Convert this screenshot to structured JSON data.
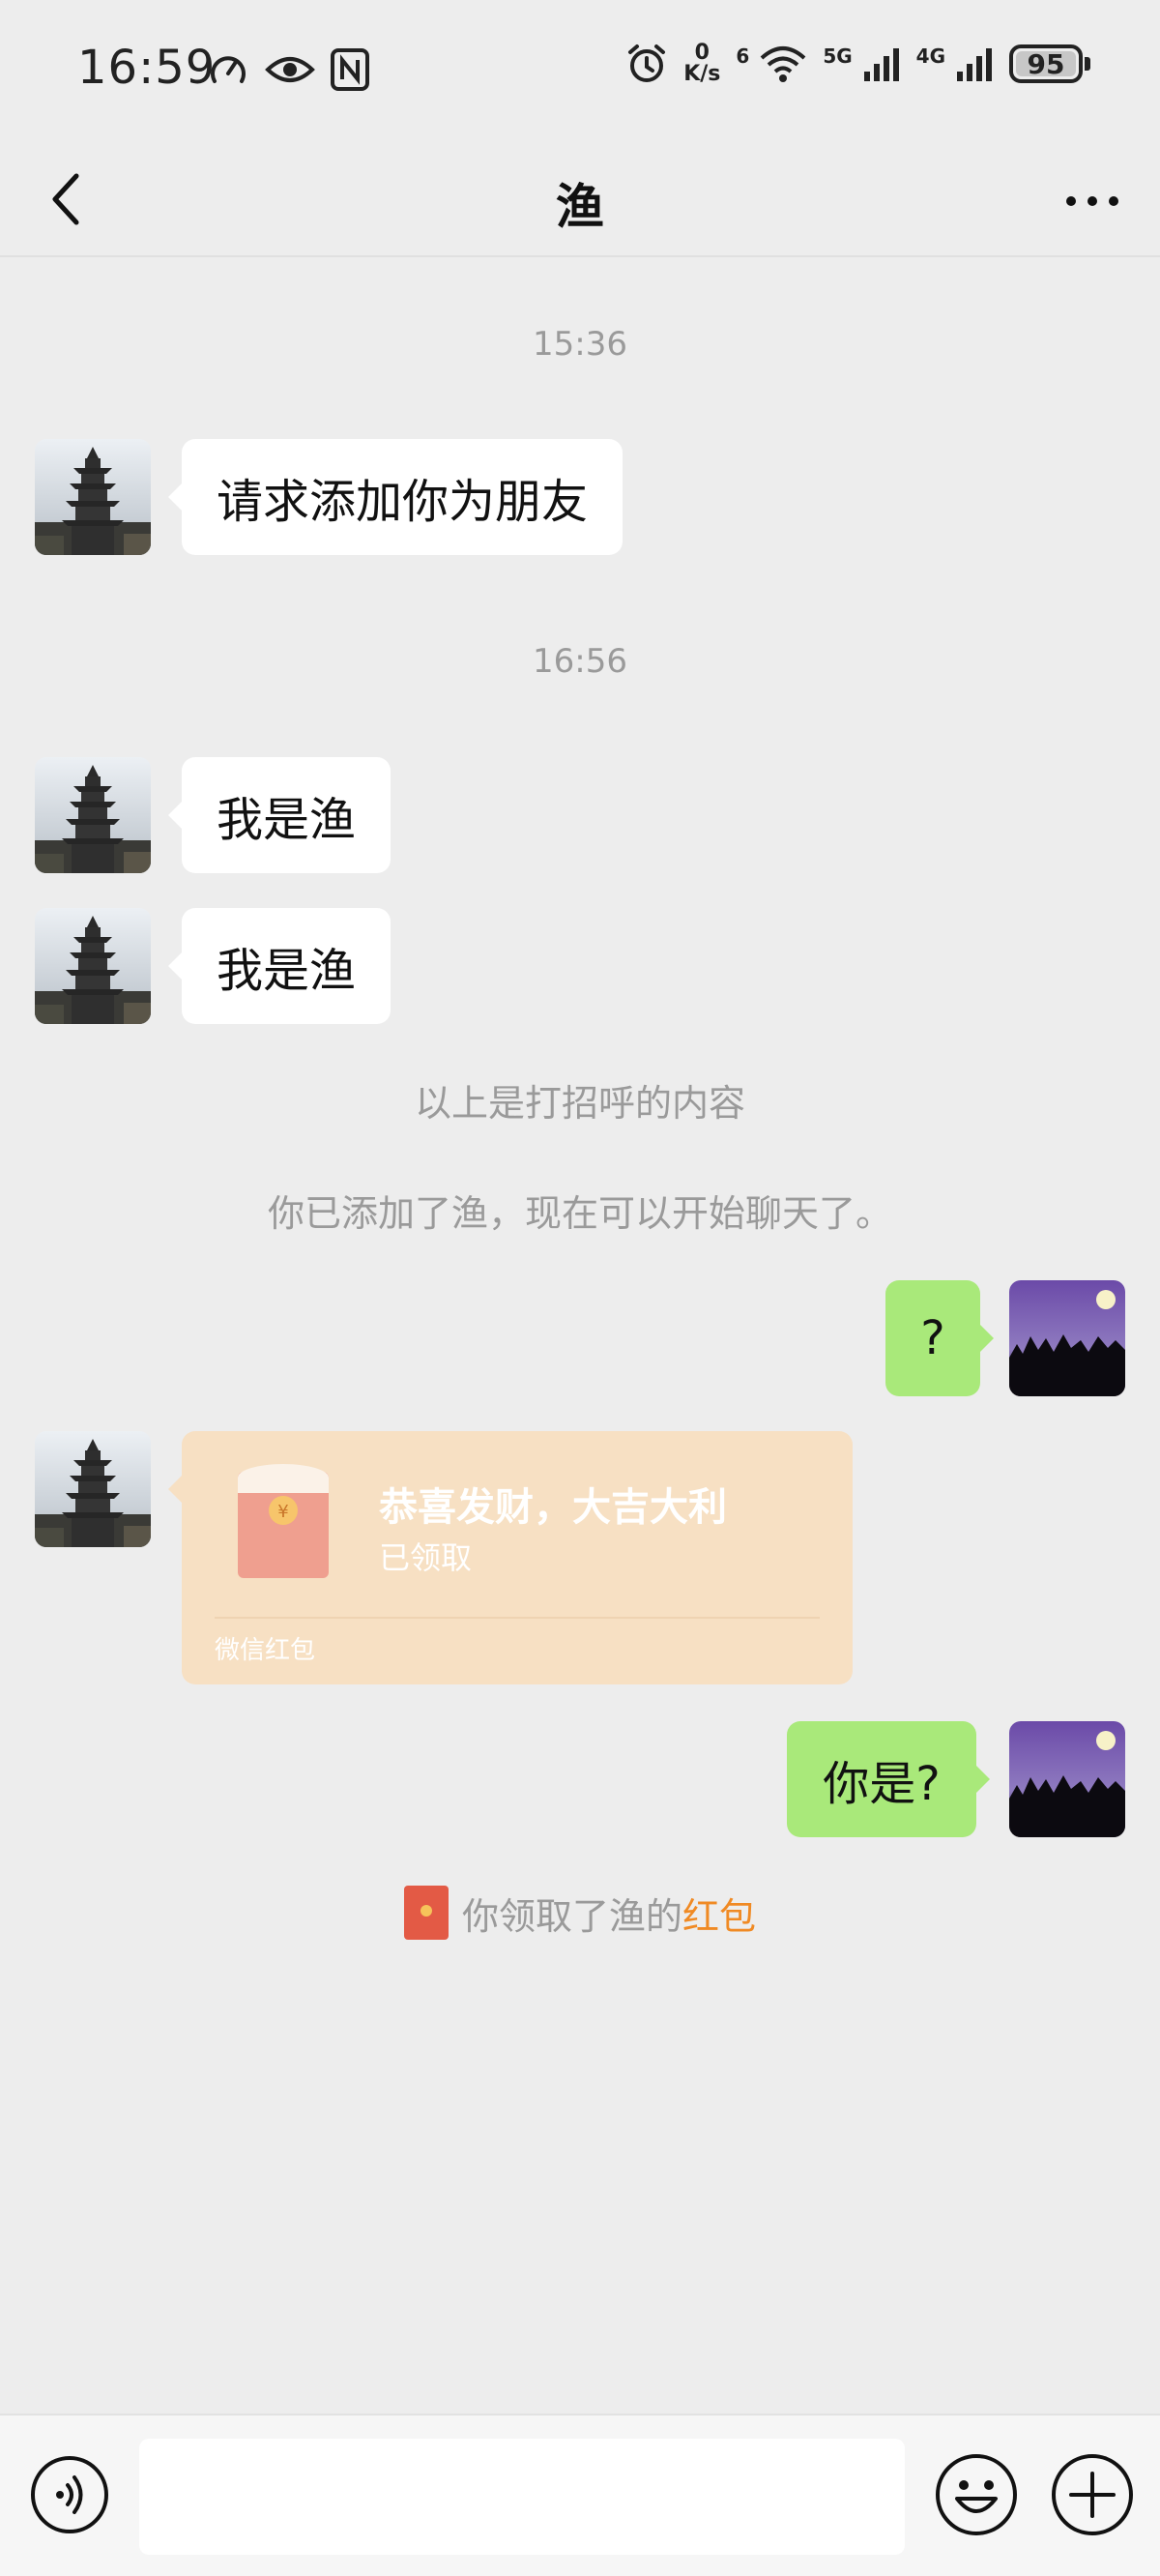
{
  "status_bar": {
    "time": "16:59",
    "net_speed_value": "0",
    "net_speed_unit": "K/s",
    "wifi_badge": "6",
    "network_1": "5G",
    "network_2": "4G",
    "battery": "95"
  },
  "nav": {
    "title": "渔"
  },
  "messages": {
    "ts1": "15:36",
    "m1": "请求添加你为朋友",
    "ts2": "16:56",
    "m2": "我是渔",
    "m3": "我是渔",
    "sys1": "以上是打招呼的内容",
    "sys2": "你已添加了渔，现在可以开始聊天了。",
    "m4": "?",
    "m5": "你是?"
  },
  "red_packet": {
    "title": "恭喜发财，大吉大利",
    "status": "已领取",
    "footer": "微信红包",
    "symbol": "¥"
  },
  "receipt": {
    "prefix": "你领取了渔的",
    "highlight": "红包"
  },
  "input": {
    "value": ""
  },
  "colors": {
    "background": "#ededed",
    "bubble_self": "#a9e97a",
    "bubble_other": "#ffffff",
    "red_packet_opened": "#f7e0c3",
    "highlight": "#f08a24"
  }
}
